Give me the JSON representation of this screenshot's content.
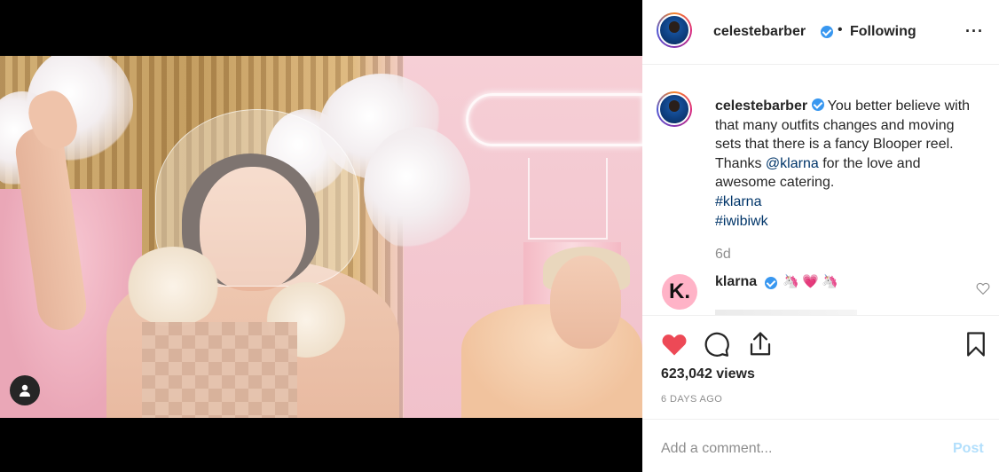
{
  "post": {
    "username": "celestebarber",
    "separator": "•",
    "follow_status": "Following",
    "more_label": "···"
  },
  "caption": {
    "username": "celestebarber",
    "text": "You better believe with that many outfits changes and moving sets that there is a fancy Blooper reel. Thanks",
    "mention": "@klarna",
    "text_after": "for the love and awesome catering.",
    "hashtags": [
      "#klarna",
      "#iwibiwk"
    ],
    "time": "6d"
  },
  "comment": {
    "username": "klarna",
    "avatar_letter": "K.",
    "emojis": [
      "🦄",
      "💗",
      "🦄"
    ]
  },
  "stats": {
    "views": "623,042 views",
    "posted": "6 DAYS AGO"
  },
  "add_comment": {
    "placeholder": "Add a comment...",
    "post_label": "Post"
  },
  "colors": {
    "like_red": "#ed4956",
    "link_blue": "#003569",
    "verified_blue": "#3897f0",
    "post_disabled": "#b2dffc",
    "klarna_pink": "#ffb3c7"
  },
  "icons": {
    "like": "heart-icon",
    "comment": "comment-icon",
    "share": "share-icon",
    "save": "bookmark-icon",
    "user_tag": "user-icon",
    "more": "ellipsis-icon"
  },
  "media": {
    "type": "video"
  }
}
